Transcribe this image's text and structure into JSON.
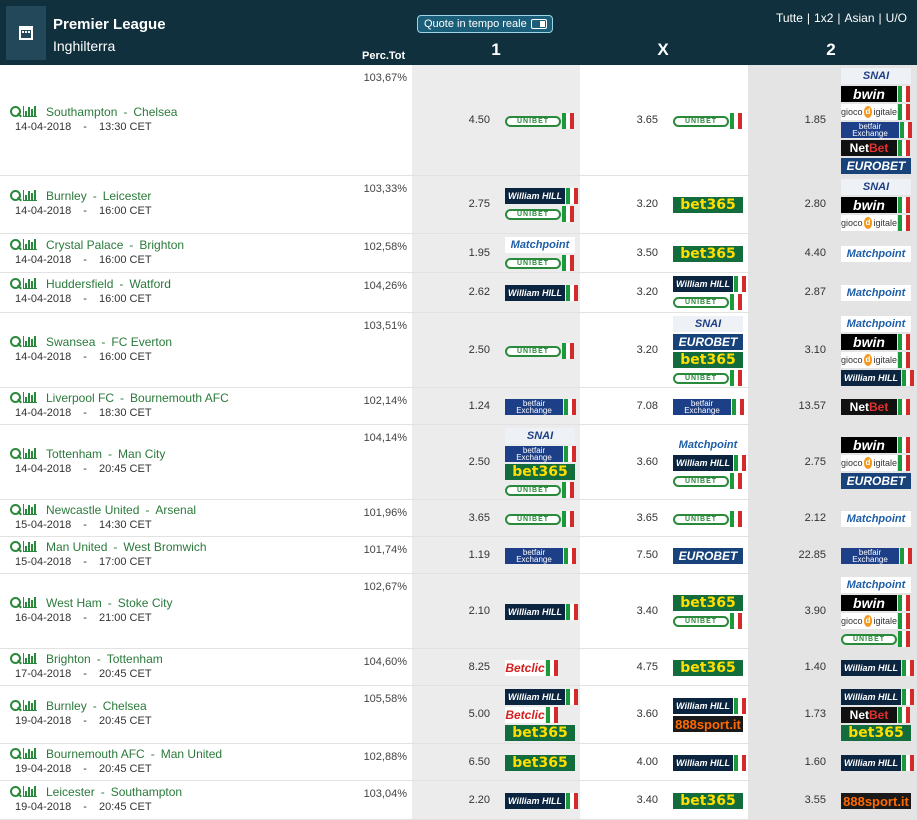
{
  "header": {
    "league": "Premier League",
    "country": "Inghilterra",
    "realtime_button": "Quote in tempo reale",
    "markets": [
      "Tutte",
      "1x2",
      "Asian",
      "U/O"
    ],
    "col_1": "1",
    "col_x": "X",
    "col_2": "2",
    "perc_label": "Perc.Tot"
  },
  "colors": {
    "header_bg": "#10303d",
    "team_link": "#2a7a3b",
    "col_grey": "#e4e4e4"
  },
  "bookmaker_names": {
    "unibet": "UNIBET",
    "bet365": "bet365",
    "william": "William HILL",
    "snai": "SNAI",
    "bwin": "bwin",
    "giocodigitale": "gioco digitale",
    "betfair_top": "betfair",
    "betfair_bottom": "Exchange",
    "netbet": "Net",
    "netbet_accent": "Bet",
    "eurobet": "EUROBET",
    "matchpoint": "Matchpoint",
    "betclic": "Betclic",
    "888": "888sport.it"
  },
  "matches": [
    {
      "home": "Southampton",
      "away": "Chelsea",
      "date": "14-04-2018",
      "time": "13:30 CET",
      "perc": "103,67%",
      "o1": "4.50",
      "ox": "3.65",
      "o2": "1.85",
      "b1": [
        "unibet"
      ],
      "bx": [
        "unibet"
      ],
      "b2": [
        "snai",
        "bwin",
        "giocodigitale",
        "betfair",
        "netbet",
        "eurobet"
      ]
    },
    {
      "home": "Burnley",
      "away": "Leicester",
      "date": "14-04-2018",
      "time": "16:00 CET",
      "perc": "103,33%",
      "o1": "2.75",
      "ox": "3.20",
      "o2": "2.80",
      "b1": [
        "william",
        "unibet"
      ],
      "bx": [
        "bet365"
      ],
      "b2": [
        "snai",
        "bwin",
        "giocodigitale"
      ]
    },
    {
      "home": "Crystal Palace",
      "away": "Brighton",
      "date": "14-04-2018",
      "time": "16:00 CET",
      "perc": "102,58%",
      "o1": "1.95",
      "ox": "3.50",
      "o2": "4.40",
      "b1": [
        "matchpoint",
        "unibet"
      ],
      "bx": [
        "bet365"
      ],
      "b2": [
        "matchpoint"
      ]
    },
    {
      "home": "Huddersfield",
      "away": "Watford",
      "date": "14-04-2018",
      "time": "16:00 CET",
      "perc": "104,26%",
      "o1": "2.62",
      "ox": "3.20",
      "o2": "2.87",
      "b1": [
        "william"
      ],
      "bx": [
        "william",
        "unibet"
      ],
      "b2": [
        "matchpoint"
      ]
    },
    {
      "home": "Swansea",
      "away": "FC Everton",
      "date": "14-04-2018",
      "time": "16:00 CET",
      "perc": "103,51%",
      "o1": "2.50",
      "ox": "3.20",
      "o2": "3.10",
      "b1": [
        "unibet"
      ],
      "bx": [
        "snai",
        "eurobet",
        "bet365",
        "unibet"
      ],
      "b2": [
        "matchpoint",
        "bwin",
        "giocodigitale",
        "william"
      ]
    },
    {
      "home": "Liverpool FC",
      "away": "Bournemouth AFC",
      "date": "14-04-2018",
      "time": "18:30 CET",
      "perc": "102,14%",
      "o1": "1.24",
      "ox": "7.08",
      "o2": "13.57",
      "b1": [
        "betfair"
      ],
      "bx": [
        "betfair"
      ],
      "b2": [
        "netbet"
      ]
    },
    {
      "home": "Tottenham",
      "away": "Man City",
      "date": "14-04-2018",
      "time": "20:45 CET",
      "perc": "104,14%",
      "o1": "2.50",
      "ox": "3.60",
      "o2": "2.75",
      "b1": [
        "snai",
        "betfair",
        "bet365",
        "unibet"
      ],
      "bx": [
        "matchpoint",
        "william",
        "unibet"
      ],
      "b2": [
        "bwin",
        "giocodigitale",
        "eurobet"
      ]
    },
    {
      "home": "Newcastle United",
      "away": "Arsenal",
      "date": "15-04-2018",
      "time": "14:30 CET",
      "perc": "101,96%",
      "o1": "3.65",
      "ox": "3.65",
      "o2": "2.12",
      "b1": [
        "unibet"
      ],
      "bx": [
        "unibet"
      ],
      "b2": [
        "matchpoint"
      ]
    },
    {
      "home": "Man United",
      "away": "West Bromwich",
      "date": "15-04-2018",
      "time": "17:00 CET",
      "perc": "101,74%",
      "o1": "1.19",
      "ox": "7.50",
      "o2": "22.85",
      "b1": [
        "betfair"
      ],
      "bx": [
        "eurobet"
      ],
      "b2": [
        "betfair"
      ]
    },
    {
      "home": "West Ham",
      "away": "Stoke City",
      "date": "16-04-2018",
      "time": "21:00 CET",
      "perc": "102,67%",
      "o1": "2.10",
      "ox": "3.40",
      "o2": "3.90",
      "b1": [
        "william"
      ],
      "bx": [
        "bet365",
        "unibet"
      ],
      "b2": [
        "matchpoint",
        "bwin",
        "giocodigitale",
        "unibet"
      ]
    },
    {
      "home": "Brighton",
      "away": "Tottenham",
      "date": "17-04-2018",
      "time": "20:45 CET",
      "perc": "104,60%",
      "o1": "8.25",
      "ox": "4.75",
      "o2": "1.40",
      "b1": [
        "betclic"
      ],
      "bx": [
        "bet365"
      ],
      "b2": [
        "william"
      ]
    },
    {
      "home": "Burnley",
      "away": "Chelsea",
      "date": "19-04-2018",
      "time": "20:45 CET",
      "perc": "105,58%",
      "o1": "5.00",
      "ox": "3.60",
      "o2": "1.73",
      "b1": [
        "william",
        "betclic",
        "bet365"
      ],
      "bx": [
        "william",
        "888"
      ],
      "b2": [
        "william",
        "netbet",
        "bet365"
      ]
    },
    {
      "home": "Bournemouth AFC",
      "away": "Man United",
      "date": "19-04-2018",
      "time": "20:45 CET",
      "perc": "102,88%",
      "o1": "6.50",
      "ox": "4.00",
      "o2": "1.60",
      "b1": [
        "bet365"
      ],
      "bx": [
        "william"
      ],
      "b2": [
        "william"
      ]
    },
    {
      "home": "Leicester",
      "away": "Southampton",
      "date": "19-04-2018",
      "time": "20:45 CET",
      "perc": "103,04%",
      "o1": "2.20",
      "ox": "3.40",
      "o2": "3.55",
      "b1": [
        "william"
      ],
      "bx": [
        "bet365"
      ],
      "b2": [
        "888"
      ]
    }
  ]
}
